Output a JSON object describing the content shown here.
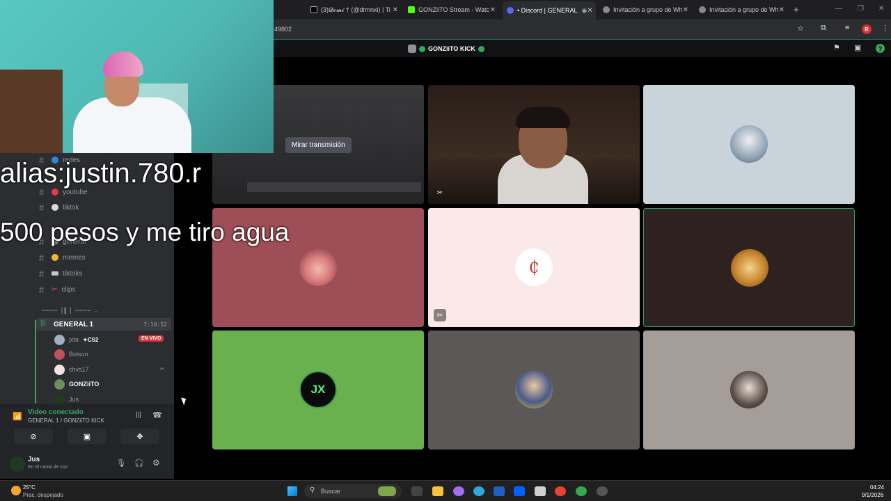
{
  "browser": {
    "tabs": [
      {
        "title": "(3)𝓓𝓸𝓶𝓲 † (@drmnxi) | Ti",
        "color": "#000000"
      },
      {
        "title": "GONZiiTO Stream - Watc",
        "color": "#53fc18"
      },
      {
        "title": "• Discord | GENERAL",
        "color": "#5865f2",
        "active": true
      },
      {
        "title": "Invitación a grupo de Wh",
        "color": "#8a8a8a"
      },
      {
        "title": "Invitación a grupo de Wh",
        "color": "#8a8a8a"
      }
    ],
    "url_fragment": "49802",
    "new_tab": "+",
    "profile_initial": "R"
  },
  "discord": {
    "channel_title": "GONZiiTO KICK",
    "watch_stream_label": "Mirar transmisión",
    "channels": [
      {
        "name": "redes",
        "emoji_color": "#2b87d8"
      },
      {
        "name": "youtube",
        "emoji_color": "#e8364e"
      },
      {
        "name": "tiktok",
        "emoji_color": "#dadada"
      },
      {
        "name": "general",
        "emoji_color": "#7d7d7d"
      },
      {
        "name": "memes",
        "emoji_color": "#f0b432"
      },
      {
        "name": "tiktoks",
        "emoji_color": "#c7c7c7"
      },
      {
        "name": "clips",
        "emoji_color": "#e24b4b"
      }
    ],
    "voice_channel": {
      "name": "GENERAL 1",
      "timer": "7:10:52",
      "members": [
        {
          "name": "jxta",
          "activity": "CS2",
          "badge": "EN VIVO"
        },
        {
          "name": "Bolson"
        },
        {
          "name": "chvs17"
        },
        {
          "name": "GONZiiTO"
        },
        {
          "name": "Jus"
        }
      ]
    },
    "voice_panel": {
      "status": "Video conectado",
      "location": "GENERAL 1 / GONZiiTO KICK"
    },
    "user": {
      "name": "Jus",
      "status": "En el canal de voz"
    },
    "tile_colors": [
      "#9e4e56",
      "#fbe8e8",
      "#2d221f",
      "#6ab04c",
      "#5c5858",
      "#a59e98",
      "#c9d3da"
    ]
  },
  "overlay": {
    "line1": "alias:justin.780.r",
    "line2": "500 pesos y me tiro agua"
  },
  "taskbar": {
    "temperature": "25°C",
    "weather": "Prac. despejado",
    "search_placeholder": "Buscar",
    "time": "04:24",
    "date": "9/1/2026"
  },
  "colors": {
    "discord_green": "#3ba55d",
    "live_red": "#da373c",
    "accent_border": "#3ba55d"
  }
}
